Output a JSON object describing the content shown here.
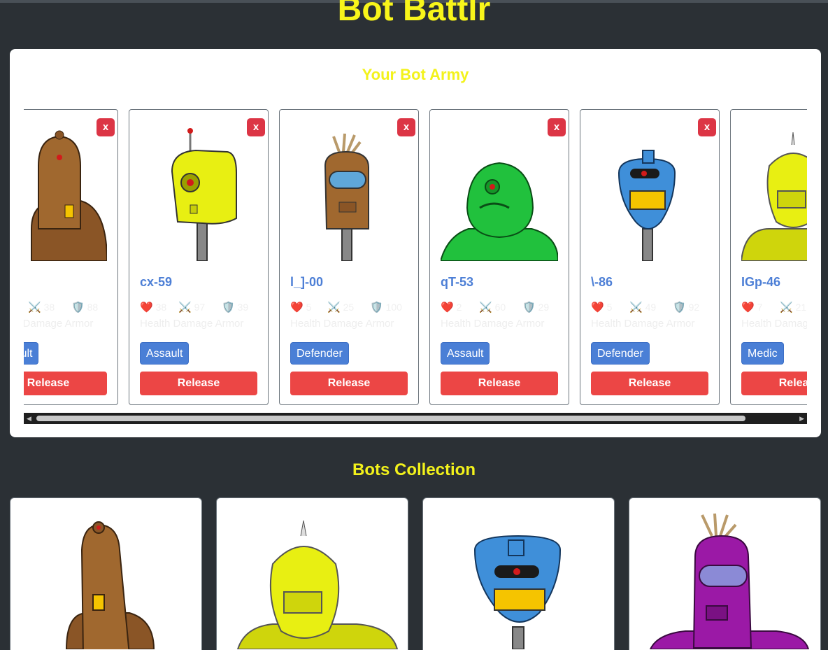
{
  "app_title": "Bot Battlr",
  "army": {
    "title": "Your Bot Army",
    "remove_label": "x",
    "release_label": "Release",
    "stat_labels": "Health  Damage Armor",
    "bots": [
      {
        "name": "",
        "health": "",
        "damage": "38",
        "armor": "88",
        "bot_class": "Assault",
        "color": "#a0682f"
      },
      {
        "name": "cx-59",
        "health": "38",
        "damage": "97",
        "armor": "39",
        "bot_class": "Assault",
        "color": "#e8ef12"
      },
      {
        "name": "l_]-00",
        "health": "5",
        "damage": "25",
        "armor": "100",
        "bot_class": "Defender",
        "color": "#a0682f"
      },
      {
        "name": "qT-53",
        "health": "2",
        "damage": "60",
        "armor": "29",
        "bot_class": "Assault",
        "color": "#21c13d"
      },
      {
        "name": "\\-86",
        "health": "5",
        "damage": "49",
        "armor": "92",
        "bot_class": "Defender",
        "color": "#3f8fd9"
      },
      {
        "name": "IGp-46",
        "health": "7",
        "damage": "21",
        "armor": "",
        "bot_class": "Medic",
        "color": "#e8ef12"
      }
    ]
  },
  "collection": {
    "title": "Bots Collection",
    "bots": [
      {
        "color": "#a0682f",
        "icon": "brown-bot-image"
      },
      {
        "color": "#e8ef12",
        "icon": "yellow-bot-image"
      },
      {
        "color": "#3f8fd9",
        "icon": "blue-bot-image"
      },
      {
        "color": "#9b19a6",
        "icon": "purple-bot-image"
      }
    ]
  }
}
